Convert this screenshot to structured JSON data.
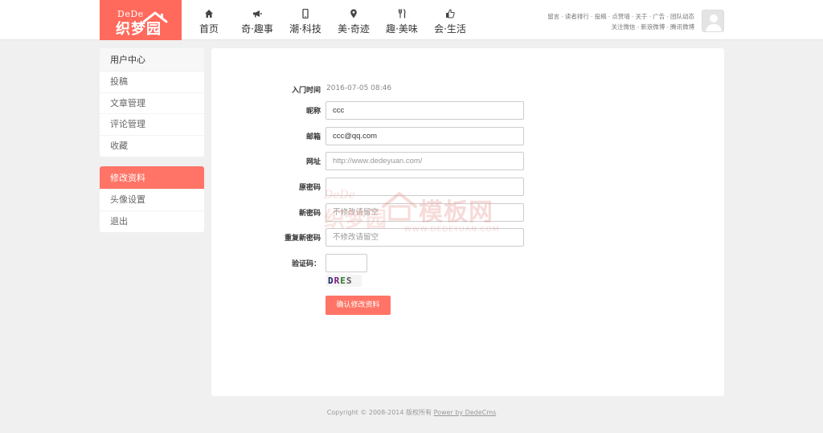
{
  "logo": {
    "en": "DeDe",
    "cn": "织梦园"
  },
  "nav": [
    {
      "label": "首页",
      "icon": "home-icon"
    },
    {
      "label": "奇·趣事",
      "icon": "megaphone-icon"
    },
    {
      "label": "潮·科技",
      "icon": "mobile-icon"
    },
    {
      "label": "美·奇迹",
      "icon": "location-pin-icon"
    },
    {
      "label": "趣·美味",
      "icon": "utensils-icon"
    },
    {
      "label": "会·生活",
      "icon": "thumbs-up-icon"
    }
  ],
  "toplinks": {
    "row1": [
      "留言",
      "读者排行",
      "投稿",
      "点赞墙",
      "关于",
      "广告",
      "团队动态"
    ],
    "row2": [
      "关注微信",
      "新浪微博",
      "腾讯微博"
    ]
  },
  "sidebar": {
    "title": "用户中心",
    "group1": [
      "投稿",
      "文章管理",
      "评论管理",
      "收藏"
    ],
    "group2": [
      "修改资料",
      "头像设置",
      "退出"
    ]
  },
  "form": {
    "join_label": "入门时间",
    "join_value": "2016-07-05 08:46",
    "nickname_label": "昵称",
    "nickname_value": "ccc",
    "email_label": "邮箱",
    "email_value": "ccc@qq.com",
    "url_label": "网址",
    "url_placeholder": "http://www.dedeyuan.com/",
    "oldpwd_label": "原密码",
    "newpwd_label": "新密码",
    "newpwd_placeholder": "不修改请留空",
    "confirmpwd_label": "重复新密码",
    "confirmpwd_placeholder": "不修改请留空",
    "captcha_label": "验证码：",
    "captcha_chars": [
      "D",
      "R",
      "E",
      "S"
    ],
    "submit_label": "确认修改资料"
  },
  "watermark": {
    "cn": "模板网",
    "en": "WWW.DEDEYUAN.COM",
    "left_top": "DeDe",
    "left_cn": "织梦园"
  },
  "footer": {
    "copyright": "Copyright © 2008-2014 版权所有 ",
    "link": "Power by DedeCms"
  },
  "colors": {
    "accent": "#ff6a5c",
    "active": "#ff7466"
  }
}
